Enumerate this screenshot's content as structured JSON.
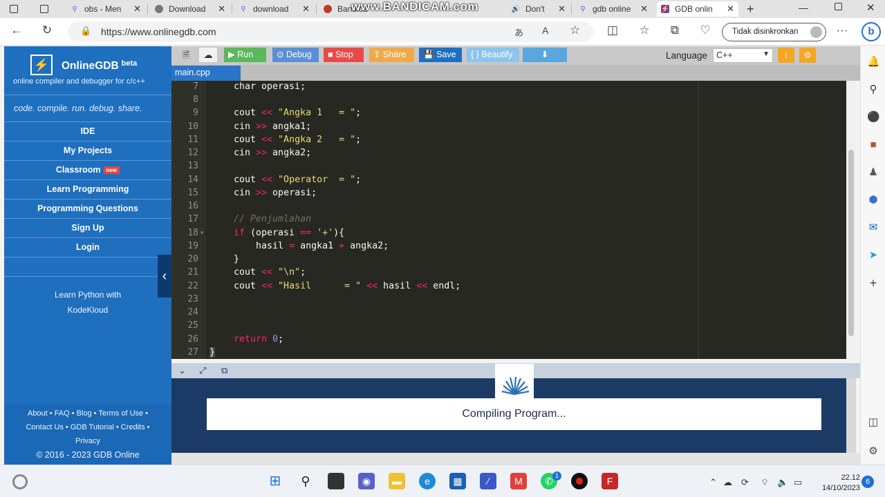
{
  "browser": {
    "tabs": [
      {
        "label": "",
        "icon": "copy-icon"
      },
      {
        "label": "",
        "icon": "sidebar-icon"
      },
      {
        "label": "obs - Men",
        "icon": "search-icon"
      },
      {
        "label": "Download",
        "icon": "globe-icon"
      },
      {
        "label": "download",
        "icon": "search-icon"
      },
      {
        "label": "Bandica",
        "icon": "record-icon"
      },
      {
        "label": "Don't",
        "icon": "speaker-icon"
      },
      {
        "label": "gdb online",
        "icon": "search-icon"
      },
      {
        "label": "GDB onlin",
        "icon": "gdb-icon"
      }
    ],
    "watermark": "www.BANDICAM.com",
    "url": "https://www.onlinegdb.com",
    "sync_label": "Tidak disinkronkan"
  },
  "sidebar": {
    "brand": "OnlineGDB",
    "brand_sup": "beta",
    "subtitle": "online compiler and debugger for c/c++",
    "tagline": "code. compile. run. debug. share.",
    "nav": [
      {
        "label": "IDE"
      },
      {
        "label": "My Projects"
      },
      {
        "label": "Classroom",
        "badge": "new"
      },
      {
        "label": "Learn Programming"
      },
      {
        "label": "Programming Questions"
      },
      {
        "label": "Sign Up"
      },
      {
        "label": "Login"
      }
    ],
    "promo_line1": "Learn Python with",
    "promo_line2": "KodeKloud",
    "footer_line1": "About • FAQ • Blog • Terms of Use •",
    "footer_line2": "Contact Us • GDB Tutorial • Credits •",
    "footer_line3": "Privacy",
    "copyright": "© 2016 - 2023 GDB Online"
  },
  "toolbar": {
    "run": "Run",
    "debug": "Debug",
    "stop": "Stop",
    "share": "Share",
    "save": "Save",
    "beautify": "{ } Beautify",
    "language_label": "Language",
    "language_value": "C++"
  },
  "file_tab": "main.cpp",
  "editor": {
    "lines": [
      {
        "n": "7"
      },
      {
        "n": "8"
      },
      {
        "n": "9"
      },
      {
        "n": "10"
      },
      {
        "n": "11"
      },
      {
        "n": "12"
      },
      {
        "n": "13"
      },
      {
        "n": "14"
      },
      {
        "n": "15"
      },
      {
        "n": "16"
      },
      {
        "n": "17"
      },
      {
        "n": "18"
      },
      {
        "n": "19"
      },
      {
        "n": "20"
      },
      {
        "n": "21"
      },
      {
        "n": "22"
      },
      {
        "n": "23"
      },
      {
        "n": "24"
      },
      {
        "n": "25"
      },
      {
        "n": "26"
      },
      {
        "n": "27"
      }
    ],
    "code": {
      "l7a": "char operasi;",
      "l9a": "cout ",
      "l9b": "<<",
      "l9c": " \"Angka 1   = \"",
      "l9d": ";",
      "l10a": "cin ",
      "l10b": ">>",
      "l10c": " angka1;",
      "l11a": "cout ",
      "l11b": "<<",
      "l11c": " \"Angka 2   = \"",
      "l11d": ";",
      "l12a": "cin ",
      "l12b": ">>",
      "l12c": " angka2;",
      "l14a": "cout ",
      "l14b": "<<",
      "l14c": " \"Operator  = \"",
      "l14d": ";",
      "l15a": "cin ",
      "l15b": ">>",
      "l15c": " operasi;",
      "l17a": "// Penjumlahan",
      "l18a": "if",
      "l18b": " (operasi ",
      "l18c": "==",
      "l18d": " ",
      "l18e": "'+'",
      "l18f": "){",
      "l19a": "    hasil ",
      "l19b": "=",
      "l19c": " angka1 ",
      "l19d": "+",
      "l19e": " angka2;",
      "l20a": "}",
      "l21a": "cout ",
      "l21b": "<<",
      "l21c": " \"\\n\"",
      "l21d": ";",
      "l22a": "cout ",
      "l22b": "<<",
      "l22c": " \"Hasil      = \" ",
      "l22d": "<<",
      "l22e": " hasil ",
      "l22f": "<<",
      "l22g": " endl;",
      "l26a": "return",
      "l26b": " ",
      "l26c": "0",
      "l26d": ";",
      "l27a": "}"
    }
  },
  "output": {
    "status": "Compiling Program..."
  },
  "taskbar": {
    "time": "22.12",
    "date": "14/10/2023",
    "notification_count": "6",
    "whatsapp_badge": "1"
  },
  "colors": {
    "sidebar": "#1f6fbf",
    "editor_bg": "#272822",
    "run": "#5cb85c",
    "debug": "#5b8fd6",
    "stop": "#e84a4a",
    "share": "#f0a94a",
    "save": "#1f6fbf",
    "output_bg": "#1b3b66"
  }
}
